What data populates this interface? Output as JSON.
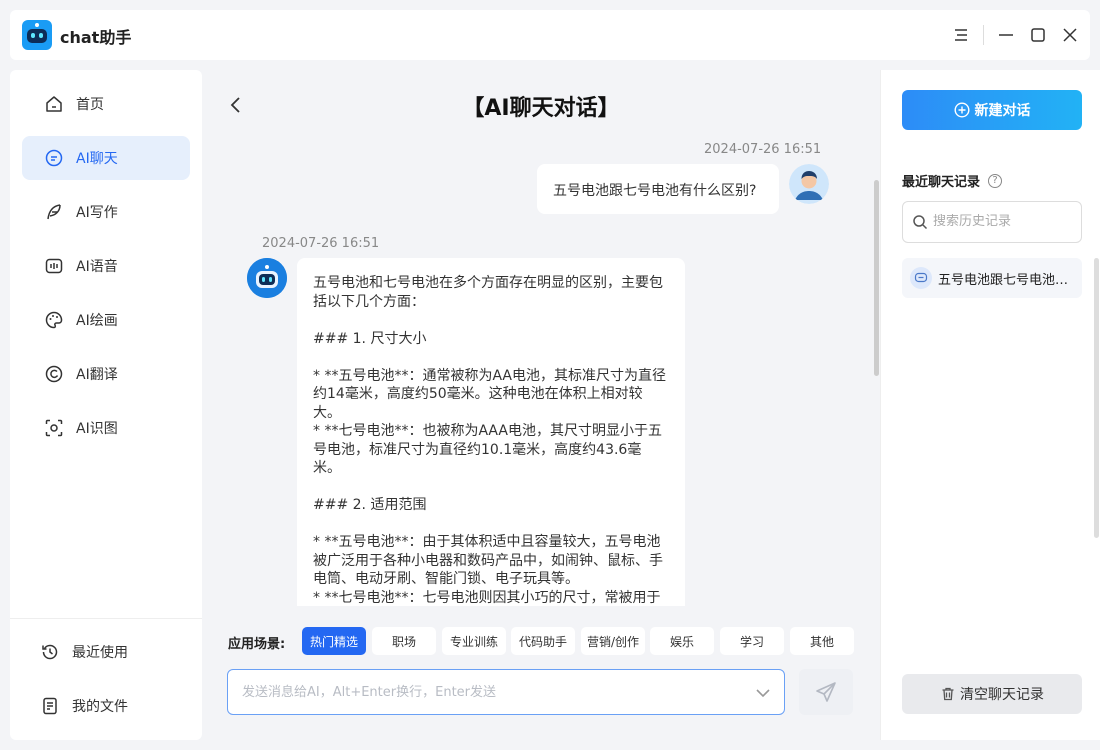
{
  "app": {
    "title": "chat助手"
  },
  "sidebar": {
    "items": [
      {
        "label": "首页",
        "icon": "home-icon"
      },
      {
        "label": "AI聊天",
        "icon": "chat-icon",
        "active": true
      },
      {
        "label": "AI写作",
        "icon": "feather-icon"
      },
      {
        "label": "AI语音",
        "icon": "voice-icon"
      },
      {
        "label": "AI绘画",
        "icon": "palette-icon"
      },
      {
        "label": "AI翻译",
        "icon": "translate-icon"
      },
      {
        "label": "AI识图",
        "icon": "scan-icon"
      }
    ],
    "bottom": [
      {
        "label": "最近使用",
        "icon": "history-icon"
      },
      {
        "label": "我的文件",
        "icon": "file-icon"
      }
    ]
  },
  "chat": {
    "title": "【AI聊天对话】",
    "messages": [
      {
        "role": "user",
        "time": "2024-07-26 16:51",
        "text": "五号电池跟七号电池有什么区别?"
      },
      {
        "role": "assistant",
        "time": "2024-07-26 16:51",
        "text": "五号电池和七号电池在多个方面存在明显的区别，主要包括以下几个方面：\n\n### 1. 尺寸大小\n\n* **五号电池**：通常被称为AA电池，其标准尺寸为直径约14毫米，高度约50毫米。这种电池在体积上相对较大。\n* **七号电池**：也被称为AAA电池，其尺寸明显小于五号电池，标准尺寸为直径约10.1毫米，高度约43.6毫米。\n\n### 2. 适用范围\n\n* **五号电池**：由于其体积适中且容量较大，五号电池被广泛用于各种小电器和数码产品中，如闹钟、鼠标、手电筒、电动牙刷、智能门锁、电子玩具等。\n* **七号电池**：七号电池则因其小巧的尺寸，常被用于体积更小、耗电量不太高的电子产品中，如计算器、小型遥控器、门禁设备以及某些家用和医疗设备。"
      }
    ]
  },
  "scenes": {
    "label": "应用场景:",
    "chips": [
      "热门精选",
      "职场",
      "专业训练",
      "代码助手",
      "营销/创作",
      "娱乐",
      "学习",
      "其他"
    ]
  },
  "input": {
    "placeholder": "发送消息给AI，Alt+Enter换行，Enter发送"
  },
  "right": {
    "new_chat": "新建对话",
    "recent_title": "最近聊天记录",
    "help": "?",
    "search_placeholder": "搜索历史记录",
    "history": [
      "五号电池跟七号电池有什么区别?"
    ],
    "clear": "清空聊天记录"
  },
  "colors": {
    "accent": "#2468f2",
    "active_bg": "#e6effc"
  }
}
